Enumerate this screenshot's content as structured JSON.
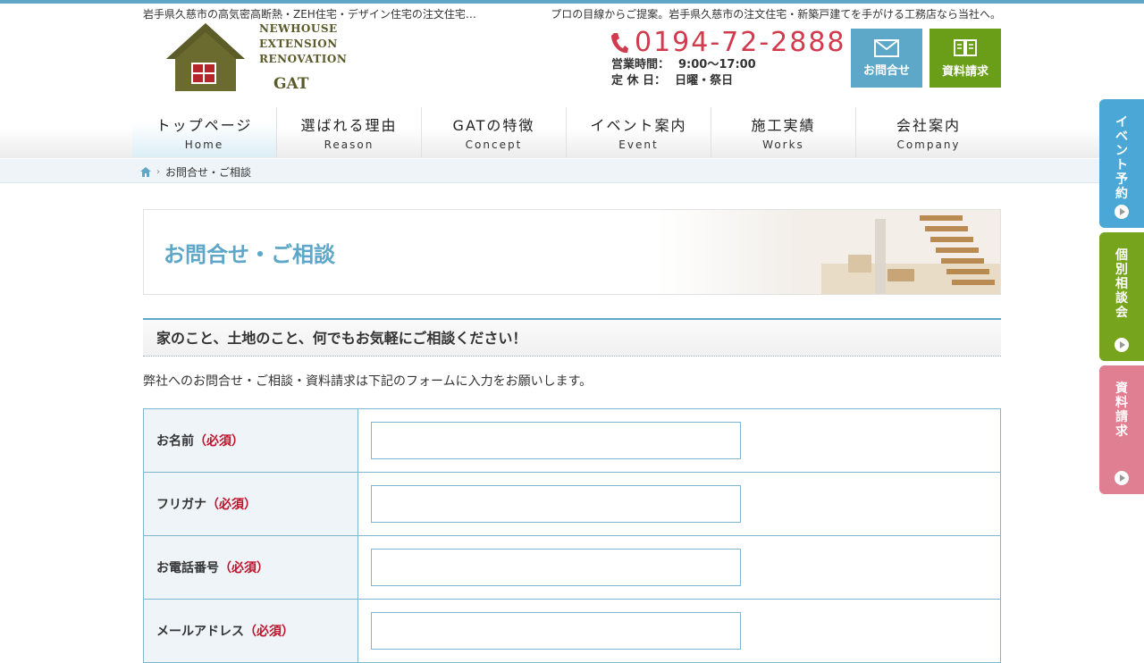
{
  "header": {
    "tagline_left": "岩手県久慈市の高気密高断熱・ZEH住宅・デザイン住宅の注文住宅…",
    "tagline_right": "プロの目線からご提案。岩手県久慈市の注文住宅・新築戸建てを手がける工務店なら当社へ。",
    "logo": {
      "line1": "NEWHOUSE",
      "line2": "EXTENSION",
      "line3": "RENOVATION",
      "brand": "GAT"
    },
    "phone": "0194-72-2888",
    "hours_label": "営業時間：",
    "hours_value": "9:00〜17:00",
    "closed_label": "定 休 日：",
    "closed_value": "日曜・祭日",
    "contact_button": "お問合せ",
    "docs_button": "資料請求"
  },
  "nav": [
    {
      "jp": "トップページ",
      "en": "Home"
    },
    {
      "jp": "選ばれる理由",
      "en": "Reason"
    },
    {
      "jp": "GATの特徴",
      "en": "Concept"
    },
    {
      "jp": "イベント案内",
      "en": "Event"
    },
    {
      "jp": "施工実績",
      "en": "Works"
    },
    {
      "jp": "会社案内",
      "en": "Company"
    }
  ],
  "breadcrumb": {
    "current": "お問合せ・ご相談"
  },
  "side_tabs": [
    {
      "label": "イベント予約"
    },
    {
      "label": "個別相談会"
    },
    {
      "label": "資料請求"
    }
  ],
  "page": {
    "title": "お問合せ・ご相談",
    "subheading": "家のこと、土地のこと、何でもお気軽にご相談ください！",
    "intro": "弊社へのお問合せ・ご相談・資料請求は下記のフォームに入力をお願いします。"
  },
  "form": {
    "required_mark": "（必須）",
    "fields": [
      {
        "label": "お名前",
        "value": ""
      },
      {
        "label": "フリガナ",
        "value": ""
      },
      {
        "label": "お電話番号",
        "value": ""
      },
      {
        "label": "メールアドレス",
        "value": ""
      }
    ]
  },
  "colors": {
    "accent": "#5ea7c8",
    "green": "#6a9e18",
    "pink": "#e07f91",
    "phone": "#d23a4d",
    "required": "#c0102a"
  }
}
